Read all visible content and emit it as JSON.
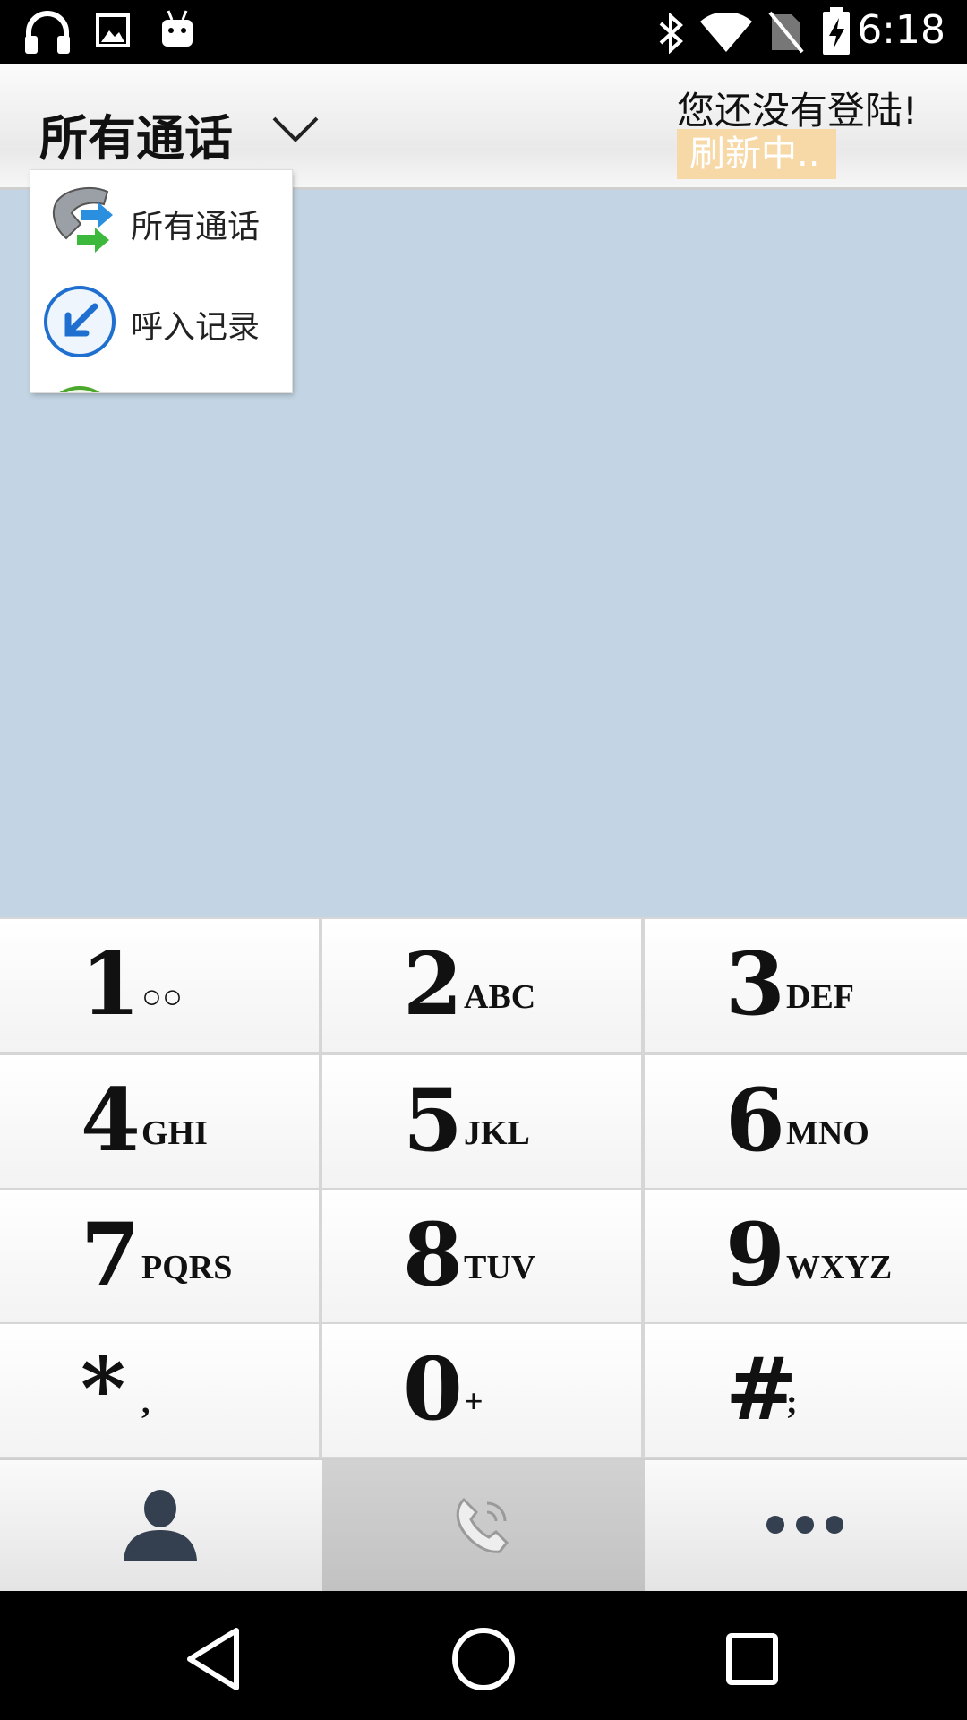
{
  "status_bar": {
    "time": "6:18",
    "left_icons": [
      "headphones-icon",
      "image-icon",
      "android-icon"
    ],
    "right_icons": [
      "bluetooth-icon",
      "wifi-icon",
      "no-sim-icon",
      "battery-charging-icon"
    ]
  },
  "header": {
    "title": "所有通话",
    "login_status": "您还没有登陆!",
    "refresh_label": "刷新中.."
  },
  "dropdown": {
    "items": [
      {
        "label": "所有通话",
        "icon": "all-calls-icon"
      },
      {
        "label": "呼入记录",
        "icon": "incoming-call-icon"
      }
    ]
  },
  "keypad": {
    "keys": [
      {
        "digit": "1",
        "letters": "○○"
      },
      {
        "digit": "2",
        "letters": "ABC"
      },
      {
        "digit": "3",
        "letters": "DEF"
      },
      {
        "digit": "4",
        "letters": "GHI"
      },
      {
        "digit": "5",
        "letters": "JKL"
      },
      {
        "digit": "6",
        "letters": "MNO"
      },
      {
        "digit": "7",
        "letters": "PQRS"
      },
      {
        "digit": "8",
        "letters": "TUV"
      },
      {
        "digit": "9",
        "letters": "WXYZ"
      },
      {
        "digit": "*",
        "letters": ","
      },
      {
        "digit": "0",
        "letters": "+"
      },
      {
        "digit": "#",
        "letters": ";"
      }
    ]
  },
  "bottom_nav": {
    "items": [
      "contacts-icon",
      "call-log-icon",
      "more-icon"
    ],
    "selected": "call-log-icon"
  },
  "colors": {
    "content_bg": "#c3d5e4",
    "refresh_badge_bg": "#f7d9a8",
    "dialpad_nav_selected": "#c8c8c8"
  }
}
